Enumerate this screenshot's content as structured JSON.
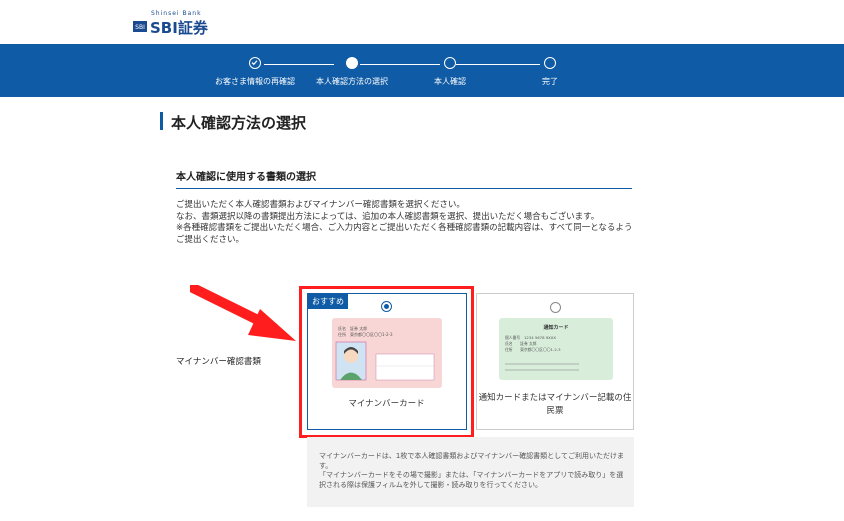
{
  "header": {
    "logo_tag": "Shinsei Bank",
    "logo_text": "SBI証券"
  },
  "steps": [
    {
      "label": "お客さま情報の再確認",
      "state": "done"
    },
    {
      "label": "本人確認方法の選択",
      "state": "current"
    },
    {
      "label": "本人確認",
      "state": "todo"
    },
    {
      "label": "完了",
      "state": "todo"
    }
  ],
  "page_title": "本人確認方法の選択",
  "section_title": "本人確認に使用する書類の選択",
  "description": [
    "ご提出いただく本人確認書類およびマイナンバー確認書類を選択ください。",
    "なお、書類選択以降の書類提出方法によっては、追加の本人確認書類を選択、提出いただく場合もございます。",
    "※各種確認書類をご提出いただく場合、ご入力内容とご提出いただく各種確認書類の記載内容は、すべて同一となるようご提出ください。"
  ],
  "row_label": "マイナンバー確認書類",
  "options": [
    {
      "badge": "おすすめ",
      "caption": "マイナンバーカード",
      "selected": true
    },
    {
      "caption": "通知カードまたはマイナンバー記載の住民票",
      "selected": false
    }
  ],
  "card_mynumber": {
    "lines": [
      "氏名　証券 太郎",
      "住所　東京都〇〇区〇〇1-2-3"
    ]
  },
  "card_notice": {
    "title": "通知カード",
    "lines": [
      "個人番号　1234 5678 9XXX",
      "氏名　　証券 太郎",
      "住所　　東京都〇〇区〇〇1-2-3"
    ]
  },
  "info": [
    "マイナンバーカードは、1枚で本人確認書類およびマイナンバー確認書類としてご利用いただけます。",
    "「マイナンバーカードをその場で撮影」または、「マイナンバーカードをアプリで読み取り」を選択される際は保護フィルムを外して撮影・読み取りを行ってください。"
  ],
  "colors": {
    "brand": "#0f5ba5",
    "highlight": "#ff1d1d",
    "card_pink": "#f7d6d5",
    "card_green": "#d8eedb"
  }
}
